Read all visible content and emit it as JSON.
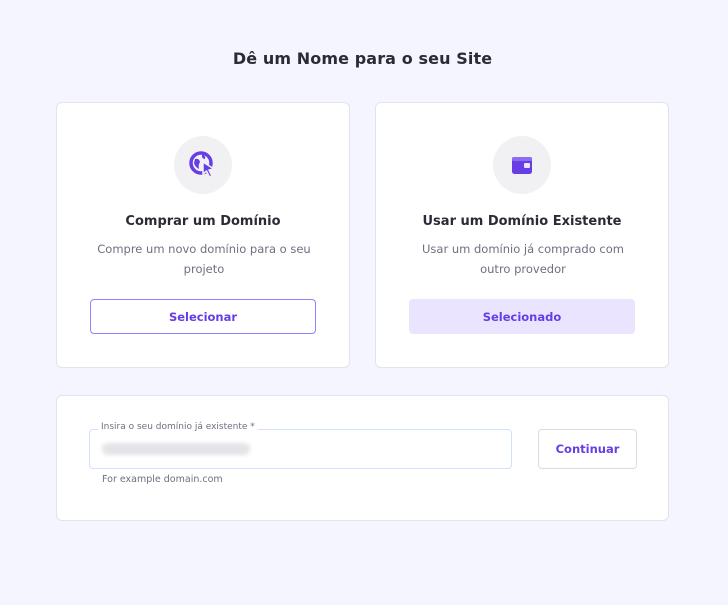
{
  "page": {
    "title": "Dê um Nome para o seu Site"
  },
  "options": {
    "buy_domain": {
      "icon": "globe-cursor-icon",
      "title": "Comprar um Domínio",
      "description": "Compre um novo domínio para o seu projeto",
      "button_label": "Selecionar",
      "selected": false
    },
    "existing_domain": {
      "icon": "wallet-icon",
      "title": "Usar um Domínio Existente",
      "description": "Usar um domínio já comprado com outro provedor",
      "button_label": "Selecionado",
      "selected": true
    }
  },
  "domain_form": {
    "field_label": "Insira o seu domínio já existente *",
    "hint": "For example domain.com",
    "continue_label": "Continuar"
  },
  "colors": {
    "accent": "#673de6",
    "selected_bg": "#ebe4ff",
    "page_bg": "#f4f5ff"
  }
}
